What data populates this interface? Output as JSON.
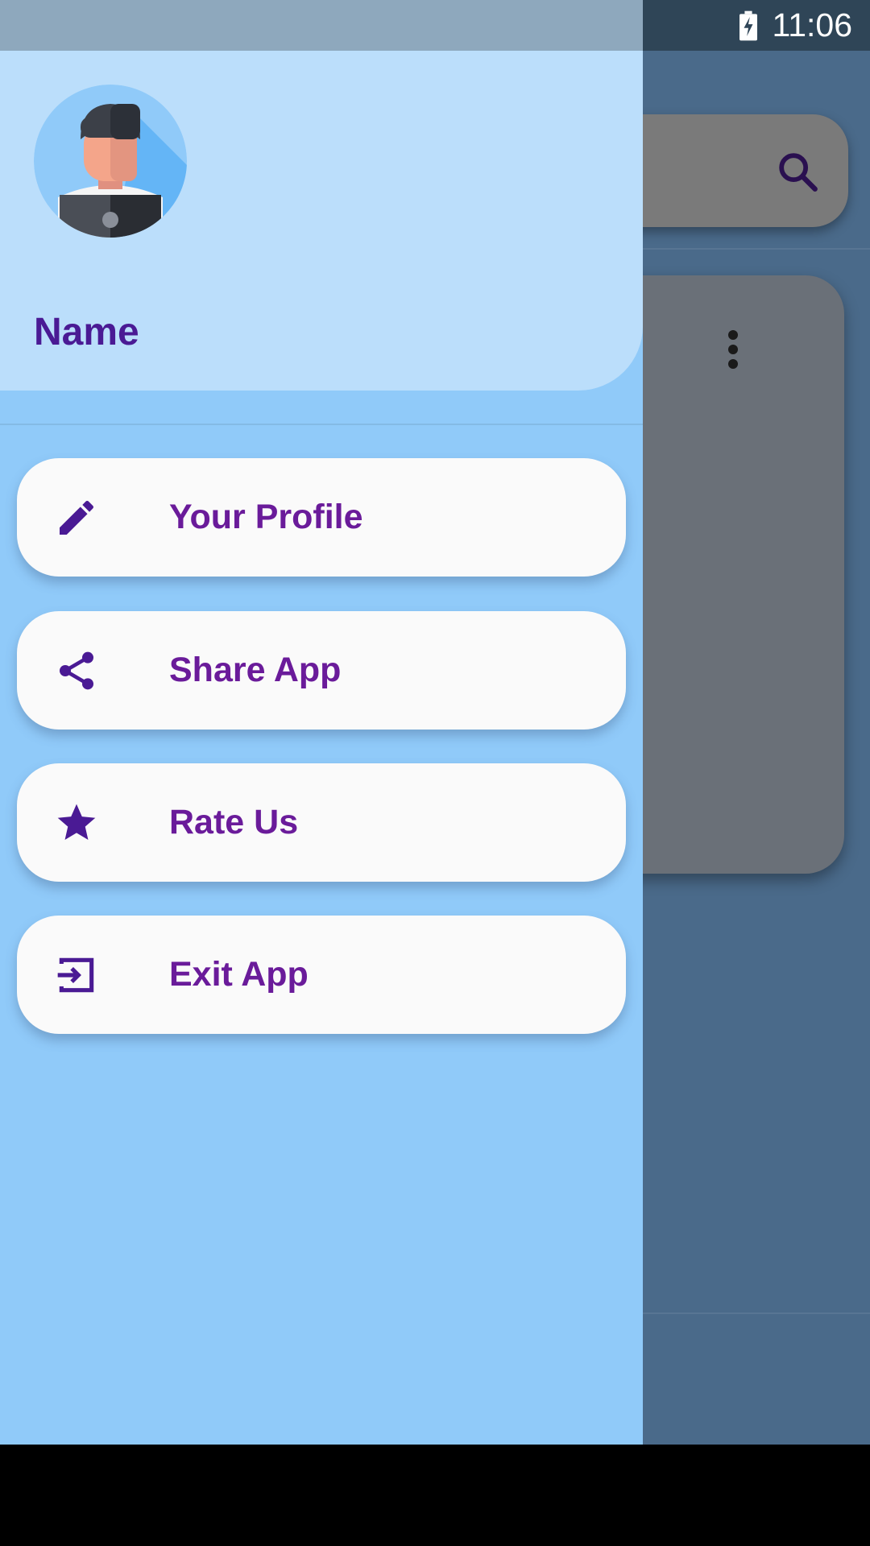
{
  "status_bar": {
    "time": "11:06",
    "battery_icon": "battery-charging-icon"
  },
  "background": {
    "search_icon": "search-icon",
    "more_icon": "more-vert-icon"
  },
  "drawer": {
    "header": {
      "avatar_icon": "user-avatar-icon",
      "name": "Name"
    },
    "items": [
      {
        "label": "Your Profile",
        "icon": "edit-pencil-icon"
      },
      {
        "label": "Share App",
        "icon": "share-icon"
      },
      {
        "label": "Rate Us",
        "icon": "star-icon"
      },
      {
        "label": "Exit App",
        "icon": "exit-icon"
      }
    ]
  },
  "colors": {
    "drawer_bg": "#90caf9",
    "header_bg": "#bbdefb",
    "name_color": "#4a1a94",
    "item_label_color": "#6a1b9a",
    "icon_color": "#4a1a94",
    "card_bg": "#fafafa"
  }
}
